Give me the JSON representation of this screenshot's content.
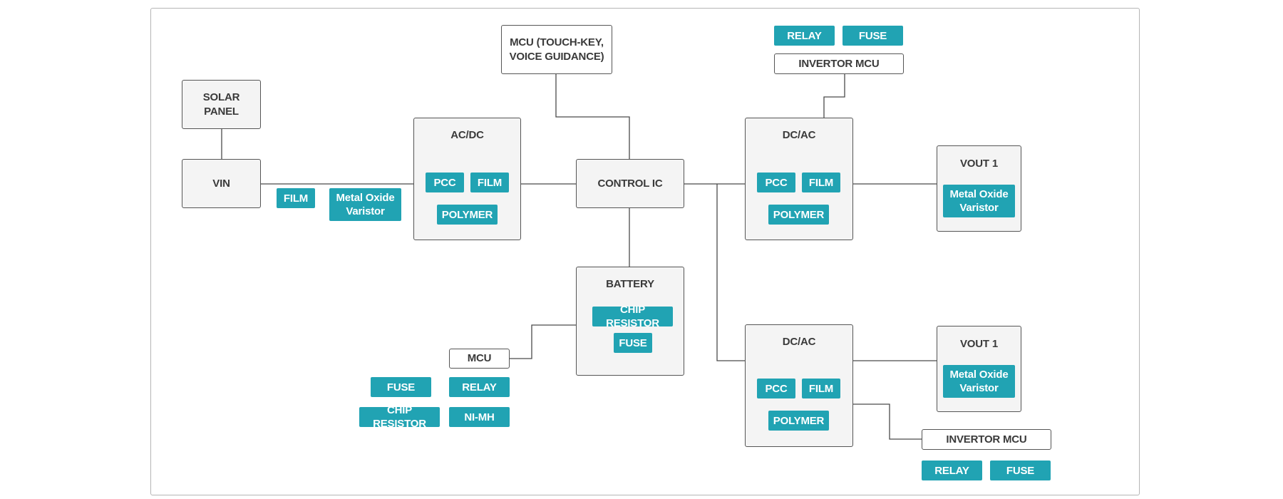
{
  "diagram": {
    "colors": {
      "chip": "#21a3b3",
      "box_fill": "#f4f4f4",
      "box_border": "#555555",
      "wire": "#4a4a4a"
    },
    "nodes": {
      "solar_panel": {
        "label": "SOLAR\nPANEL"
      },
      "vin": {
        "label": "VIN"
      },
      "acdc": {
        "label": "AC/DC",
        "chips": [
          "PCC",
          "FILM",
          "POLYMER"
        ]
      },
      "mcu_top": {
        "label": "MCU (TOUCH-KEY,\nVOICE GUIDANCE)"
      },
      "control_ic": {
        "label": "CONTROL IC"
      },
      "battery": {
        "label": "BATTERY",
        "chips": [
          "CHIP RESISTOR",
          "FUSE"
        ]
      },
      "mcu_battery": {
        "label": "MCU"
      },
      "dcac_top": {
        "label": "DC/AC",
        "chips": [
          "PCC",
          "FILM",
          "POLYMER"
        ]
      },
      "dcac_bottom": {
        "label": "DC/AC",
        "chips": [
          "PCC",
          "FILM",
          "POLYMER"
        ]
      },
      "vout_top": {
        "label": "VOUT 1",
        "chips": [
          "Metal Oxide\nVaristor"
        ]
      },
      "vout_bottom": {
        "label": "VOUT 1",
        "chips": [
          "Metal Oxide\nVaristor"
        ]
      },
      "invertor_mcu_top": {
        "label": "INVERTOR MCU"
      },
      "invertor_mcu_bottom": {
        "label": "INVERTOR MCU"
      }
    },
    "line_chips": {
      "vin_film": "FILM",
      "vin_mov": "Metal Oxide\nVaristor",
      "inv_top_relay": "RELAY",
      "inv_top_fuse": "FUSE",
      "inv_bottom_relay": "RELAY",
      "inv_bottom_fuse": "FUSE",
      "mcu_fuse": "FUSE",
      "mcu_relay": "RELAY",
      "mcu_chip_resistor": "CHIP RESISTOR",
      "mcu_nimh": "NI-MH"
    }
  }
}
